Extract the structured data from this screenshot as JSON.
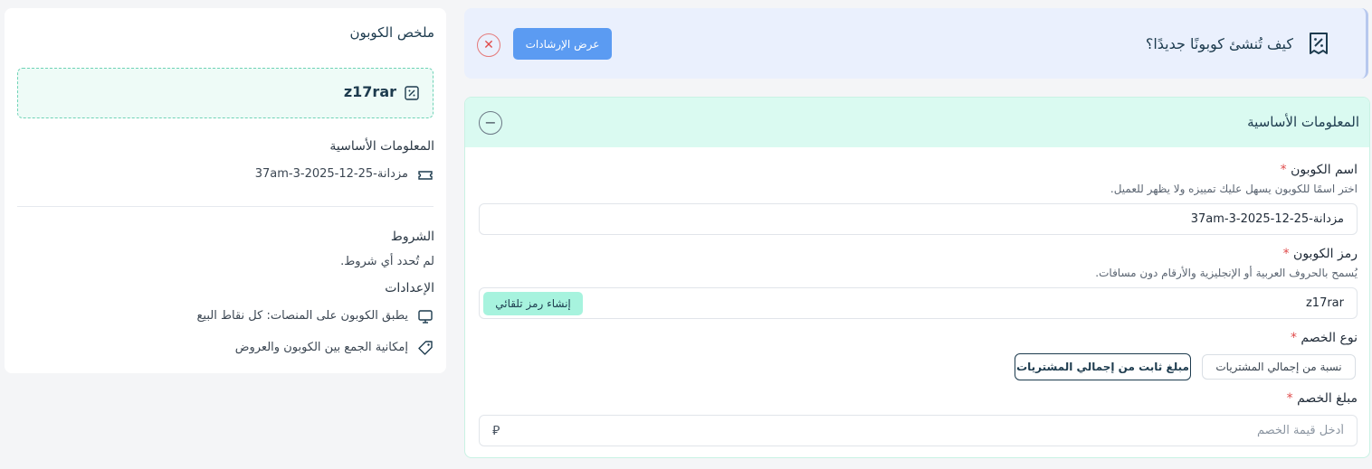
{
  "summary": {
    "title": "ملخص الكوبون",
    "code": "z17rar",
    "basic_info_heading": "المعلومات الأساسية",
    "coupon_name": "مزدانة-25-12-2025-3-37am",
    "conditions_heading": "الشروط",
    "conditions_value": "لم تُحدد أي شروط.",
    "settings_heading": "الإعدادات",
    "platforms_text": "يطبق الكوبون على المنصات: كل نقاط البيع",
    "combine_text": "إمكانية الجمع بين الكوبون والعروض"
  },
  "guide": {
    "title": "كيف تُنشئ كوبونًا جديدًا؟",
    "button_label": "عرض الإرشادات",
    "close_icon": "✕"
  },
  "basic_info": {
    "title": "المعلومات الأساسية",
    "collapse_icon": "−",
    "name_label": "اسم الكوبون",
    "name_hint": "اختر اسمًا للكوبون يسهل عليك تمييزه ولا يظهر للعميل.",
    "name_value": "مزدانة-25-12-2025-3-37am",
    "code_label": "رمز الكوبون",
    "code_hint": "يُسمح بالحروف العربية أو الإنجليزية والأرقام دون مسافات.",
    "code_value": "z17rar",
    "generate_label": "إنشاء رمز تلقائي",
    "discount_type_label": "نوع الخصم",
    "discount_options": [
      "نسبة من إجمالي المشتريات",
      "مبلغ ثابت من إجمالي المشتريات"
    ],
    "discount_selected_index": 1,
    "amount_label": "مبلغ الخصم",
    "amount_placeholder": "أدخل قيمة الخصم",
    "currency_symbol": "⃁",
    "required_mark": "*"
  },
  "colors": {
    "accent_green": "#a7f3de",
    "header_green": "#dafaf1",
    "primary_blue": "#5b9bf2",
    "danger_red": "#e04b4b",
    "navy": "#1d3b4e"
  }
}
